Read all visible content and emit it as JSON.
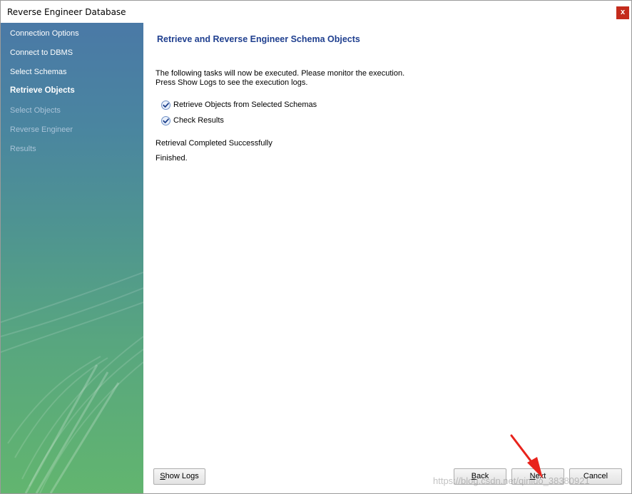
{
  "window": {
    "title": "Reverse Engineer Database",
    "close_label": "x"
  },
  "sidebar": {
    "items": [
      {
        "label": "Connection Options",
        "state": "done"
      },
      {
        "label": "Connect to DBMS",
        "state": "done"
      },
      {
        "label": "Select Schemas",
        "state": "done"
      },
      {
        "label": "Retrieve Objects",
        "state": "active"
      },
      {
        "label": "Select Objects",
        "state": "disabled"
      },
      {
        "label": "Reverse Engineer",
        "state": "disabled"
      },
      {
        "label": "Results",
        "state": "disabled"
      }
    ]
  },
  "main": {
    "heading": "Retrieve and Reverse Engineer Schema Objects",
    "description_line1": "The following tasks will now be executed. Please monitor the execution.",
    "description_line2": "Press Show Logs to see the execution logs.",
    "tasks": [
      {
        "label": "Retrieve Objects from Selected Schemas",
        "icon": "check-icon"
      },
      {
        "label": "Check Results",
        "icon": "check-icon"
      }
    ],
    "status": "Retrieval Completed Successfully",
    "finished": "Finished."
  },
  "footer": {
    "show_logs_first": "S",
    "show_logs_rest": "how Logs",
    "back_first": "B",
    "back_rest": "ack",
    "next_first": "N",
    "next_rest": "ext",
    "cancel_label": "Cancel"
  },
  "watermark": "https://blog.csdn.net/qinluo_38380921",
  "colors": {
    "heading": "#1f3f8f",
    "close": "#c42b1c",
    "annotation_arrow": "#e8231c"
  }
}
